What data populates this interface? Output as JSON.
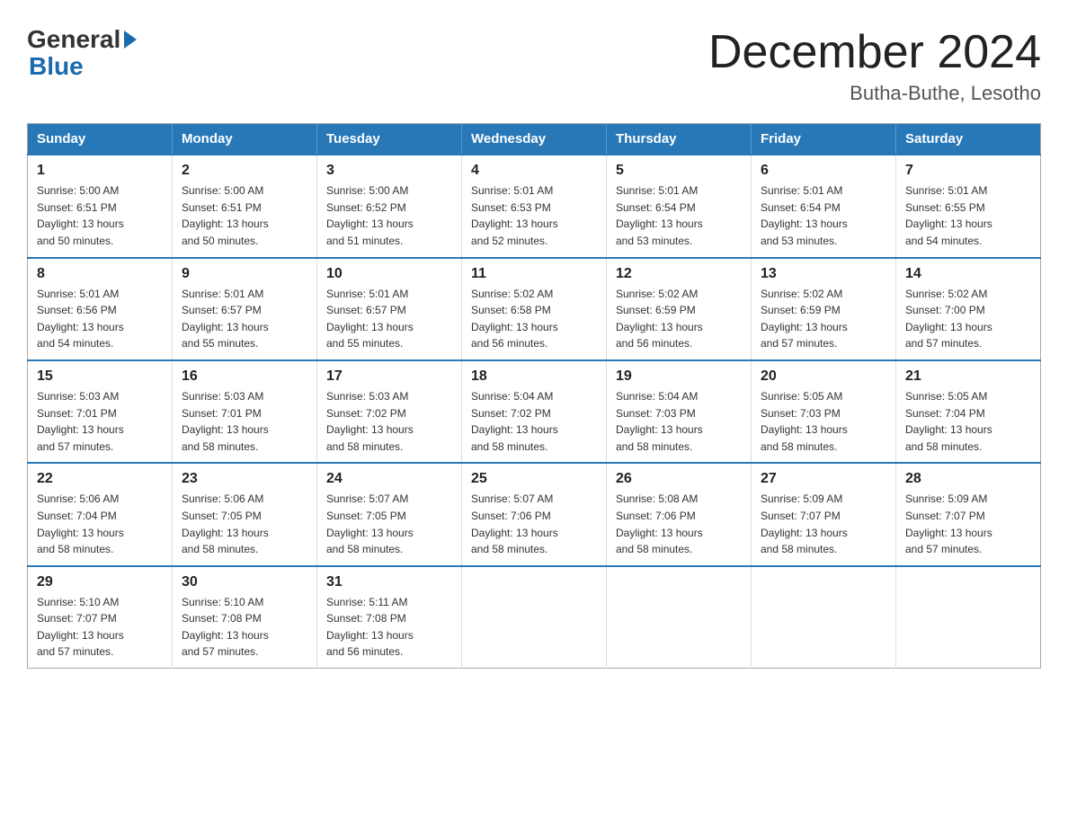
{
  "header": {
    "logo": {
      "general": "General",
      "blue": "Blue"
    },
    "title": "December 2024",
    "location": "Butha-Buthe, Lesotho"
  },
  "days_of_week": [
    "Sunday",
    "Monday",
    "Tuesday",
    "Wednesday",
    "Thursday",
    "Friday",
    "Saturday"
  ],
  "weeks": [
    [
      {
        "day": "1",
        "sunrise": "5:00 AM",
        "sunset": "6:51 PM",
        "daylight": "13 hours and 50 minutes."
      },
      {
        "day": "2",
        "sunrise": "5:00 AM",
        "sunset": "6:51 PM",
        "daylight": "13 hours and 50 minutes."
      },
      {
        "day": "3",
        "sunrise": "5:00 AM",
        "sunset": "6:52 PM",
        "daylight": "13 hours and 51 minutes."
      },
      {
        "day": "4",
        "sunrise": "5:01 AM",
        "sunset": "6:53 PM",
        "daylight": "13 hours and 52 minutes."
      },
      {
        "day": "5",
        "sunrise": "5:01 AM",
        "sunset": "6:54 PM",
        "daylight": "13 hours and 53 minutes."
      },
      {
        "day": "6",
        "sunrise": "5:01 AM",
        "sunset": "6:54 PM",
        "daylight": "13 hours and 53 minutes."
      },
      {
        "day": "7",
        "sunrise": "5:01 AM",
        "sunset": "6:55 PM",
        "daylight": "13 hours and 54 minutes."
      }
    ],
    [
      {
        "day": "8",
        "sunrise": "5:01 AM",
        "sunset": "6:56 PM",
        "daylight": "13 hours and 54 minutes."
      },
      {
        "day": "9",
        "sunrise": "5:01 AM",
        "sunset": "6:57 PM",
        "daylight": "13 hours and 55 minutes."
      },
      {
        "day": "10",
        "sunrise": "5:01 AM",
        "sunset": "6:57 PM",
        "daylight": "13 hours and 55 minutes."
      },
      {
        "day": "11",
        "sunrise": "5:02 AM",
        "sunset": "6:58 PM",
        "daylight": "13 hours and 56 minutes."
      },
      {
        "day": "12",
        "sunrise": "5:02 AM",
        "sunset": "6:59 PM",
        "daylight": "13 hours and 56 minutes."
      },
      {
        "day": "13",
        "sunrise": "5:02 AM",
        "sunset": "6:59 PM",
        "daylight": "13 hours and 57 minutes."
      },
      {
        "day": "14",
        "sunrise": "5:02 AM",
        "sunset": "7:00 PM",
        "daylight": "13 hours and 57 minutes."
      }
    ],
    [
      {
        "day": "15",
        "sunrise": "5:03 AM",
        "sunset": "7:01 PM",
        "daylight": "13 hours and 57 minutes."
      },
      {
        "day": "16",
        "sunrise": "5:03 AM",
        "sunset": "7:01 PM",
        "daylight": "13 hours and 58 minutes."
      },
      {
        "day": "17",
        "sunrise": "5:03 AM",
        "sunset": "7:02 PM",
        "daylight": "13 hours and 58 minutes."
      },
      {
        "day": "18",
        "sunrise": "5:04 AM",
        "sunset": "7:02 PM",
        "daylight": "13 hours and 58 minutes."
      },
      {
        "day": "19",
        "sunrise": "5:04 AM",
        "sunset": "7:03 PM",
        "daylight": "13 hours and 58 minutes."
      },
      {
        "day": "20",
        "sunrise": "5:05 AM",
        "sunset": "7:03 PM",
        "daylight": "13 hours and 58 minutes."
      },
      {
        "day": "21",
        "sunrise": "5:05 AM",
        "sunset": "7:04 PM",
        "daylight": "13 hours and 58 minutes."
      }
    ],
    [
      {
        "day": "22",
        "sunrise": "5:06 AM",
        "sunset": "7:04 PM",
        "daylight": "13 hours and 58 minutes."
      },
      {
        "day": "23",
        "sunrise": "5:06 AM",
        "sunset": "7:05 PM",
        "daylight": "13 hours and 58 minutes."
      },
      {
        "day": "24",
        "sunrise": "5:07 AM",
        "sunset": "7:05 PM",
        "daylight": "13 hours and 58 minutes."
      },
      {
        "day": "25",
        "sunrise": "5:07 AM",
        "sunset": "7:06 PM",
        "daylight": "13 hours and 58 minutes."
      },
      {
        "day": "26",
        "sunrise": "5:08 AM",
        "sunset": "7:06 PM",
        "daylight": "13 hours and 58 minutes."
      },
      {
        "day": "27",
        "sunrise": "5:09 AM",
        "sunset": "7:07 PM",
        "daylight": "13 hours and 58 minutes."
      },
      {
        "day": "28",
        "sunrise": "5:09 AM",
        "sunset": "7:07 PM",
        "daylight": "13 hours and 57 minutes."
      }
    ],
    [
      {
        "day": "29",
        "sunrise": "5:10 AM",
        "sunset": "7:07 PM",
        "daylight": "13 hours and 57 minutes."
      },
      {
        "day": "30",
        "sunrise": "5:10 AM",
        "sunset": "7:08 PM",
        "daylight": "13 hours and 57 minutes."
      },
      {
        "day": "31",
        "sunrise": "5:11 AM",
        "sunset": "7:08 PM",
        "daylight": "13 hours and 56 minutes."
      },
      null,
      null,
      null,
      null
    ]
  ],
  "labels": {
    "sunrise": "Sunrise:",
    "sunset": "Sunset:",
    "daylight": "Daylight:"
  },
  "colors": {
    "header_bg": "#2878b8",
    "border_blue": "#2878b8"
  }
}
